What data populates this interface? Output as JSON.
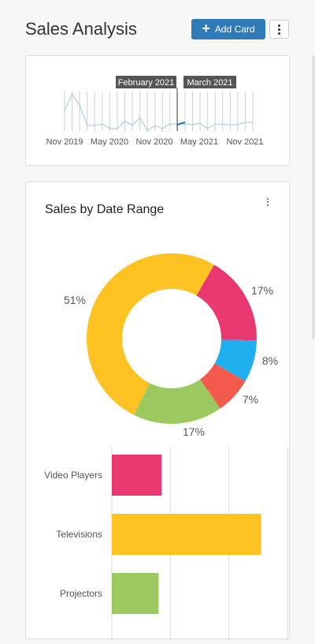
{
  "header": {
    "title": "Sales Analysis",
    "add_card_label": "Add Card"
  },
  "timeline": {
    "tooltips": [
      "February 2021",
      "March 2021"
    ],
    "x_labels": [
      "Nov 2019",
      "May 2020",
      "Nov 2020",
      "May 2021",
      "Nov 2021"
    ],
    "colors": {
      "line": "#9ecae8",
      "selected": "#1f77b4",
      "tooltip_bg": "#555555"
    }
  },
  "card": {
    "title": "Sales by Date Range"
  },
  "chart_data": [
    {
      "type": "pie",
      "title": "Sales by Date Range",
      "donut": true,
      "slices": [
        {
          "label": "Video Players",
          "percent": 17,
          "value_label": "17%",
          "color": "#e8386f"
        },
        {
          "label": "",
          "percent": 8,
          "value_label": "8%",
          "color": "#1eb0ee"
        },
        {
          "label": "",
          "percent": 7,
          "value_label": "7%",
          "color": "#f25b4b"
        },
        {
          "label": "Projectors",
          "percent": 17,
          "value_label": "17%",
          "color": "#9cc95f"
        },
        {
          "label": "Televisions",
          "percent": 51,
          "value_label": "51%",
          "color": "#fec322"
        }
      ]
    },
    {
      "type": "bar",
      "orientation": "horizontal",
      "categories": [
        "Video Players",
        "Televisions",
        "Projectors"
      ],
      "values": [
        17,
        51,
        16
      ],
      "colors": [
        "#e8386f",
        "#fec322",
        "#9cc95f"
      ],
      "xlim": [
        0,
        60
      ],
      "grid": true
    }
  ]
}
